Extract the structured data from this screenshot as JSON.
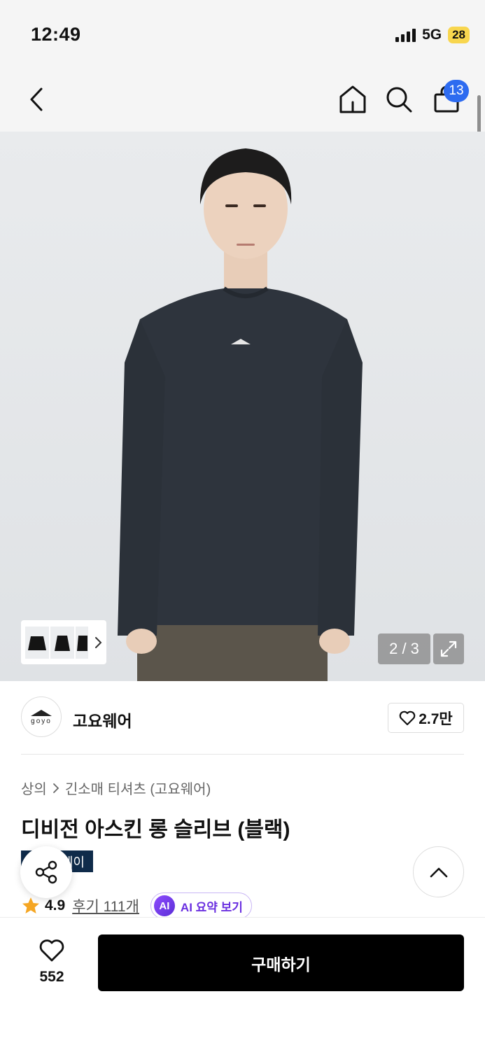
{
  "status_bar": {
    "time": "12:49",
    "network": "5G",
    "battery": "28"
  },
  "nav": {
    "back_icon": "chevron-left-icon",
    "home_icon": "home-icon",
    "search_icon": "search-icon",
    "cart_icon": "shopping-bag-icon",
    "cart_count": "13"
  },
  "gallery": {
    "counter": "2 / 3",
    "expand_icon": "expand-icon",
    "thumbnails": [
      "thumb-1",
      "thumb-2",
      "thumb-3"
    ],
    "colors": {
      "background": "#e5e7ea",
      "shirt": "#2e343d",
      "pants": "#5b554b"
    }
  },
  "brand": {
    "logo_text": "goyo",
    "name": "고요웨어",
    "likes": "2.7만"
  },
  "product": {
    "breadcrumb": [
      "상의",
      "긴소매 티셔츠 (고요웨어)"
    ],
    "title": "디비전 아스킨 롱 슬리브 (블랙)",
    "tag": "에이",
    "rating": "4.9",
    "review_text": "후기 111개",
    "ai_badge": "AI",
    "ai_summary_label": "AI 요약 보기"
  },
  "bottom_bar": {
    "wish_count": "552",
    "buy_label": "구매하기"
  },
  "colors": {
    "accent_blue": "#2d6bf0",
    "star": "#f5a623",
    "ai_purple": "#6a2fe0",
    "tag_navy": "#0f2b4a"
  }
}
